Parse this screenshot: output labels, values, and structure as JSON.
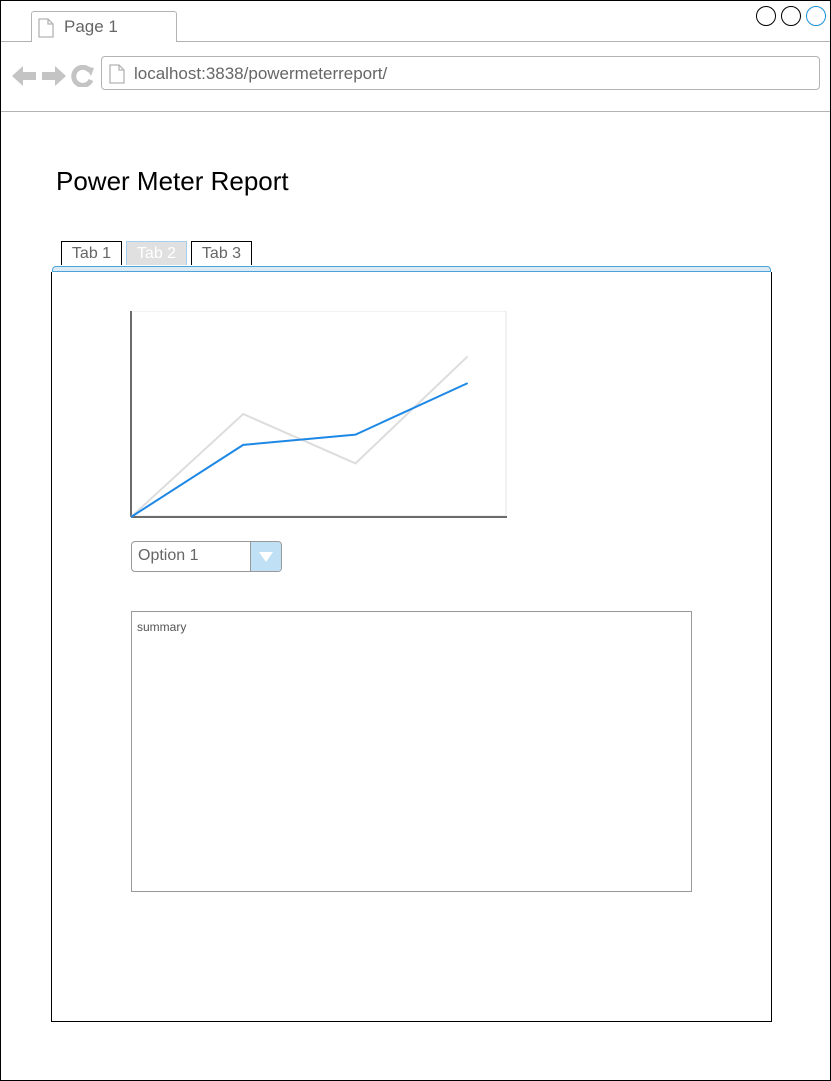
{
  "browser": {
    "tab_title": "Page 1",
    "url": "localhost:3838/powermeterreport/"
  },
  "page": {
    "title": "Power Meter Report"
  },
  "tabs": [
    {
      "label": "Tab 1",
      "active": false
    },
    {
      "label": "Tab 2",
      "active": true
    },
    {
      "label": "Tab 3",
      "active": false
    }
  ],
  "chart_data": {
    "type": "line",
    "x": [
      0,
      1,
      2,
      3
    ],
    "series": [
      {
        "values": [
          0,
          50,
          26,
          78
        ],
        "color": "#dddddd"
      },
      {
        "values": [
          0,
          35,
          40,
          65
        ],
        "color": "#1e88e5"
      }
    ],
    "xlim": [
      0,
      3.35
    ],
    "ylim": [
      0,
      100
    ],
    "grid": false
  },
  "dropdown": {
    "selected": "Option 1"
  },
  "summary": {
    "label": "summary"
  },
  "colors": {
    "accent": "#1e88e5",
    "accent_light": "#bfe0f5",
    "muted_line": "#dddddd"
  }
}
